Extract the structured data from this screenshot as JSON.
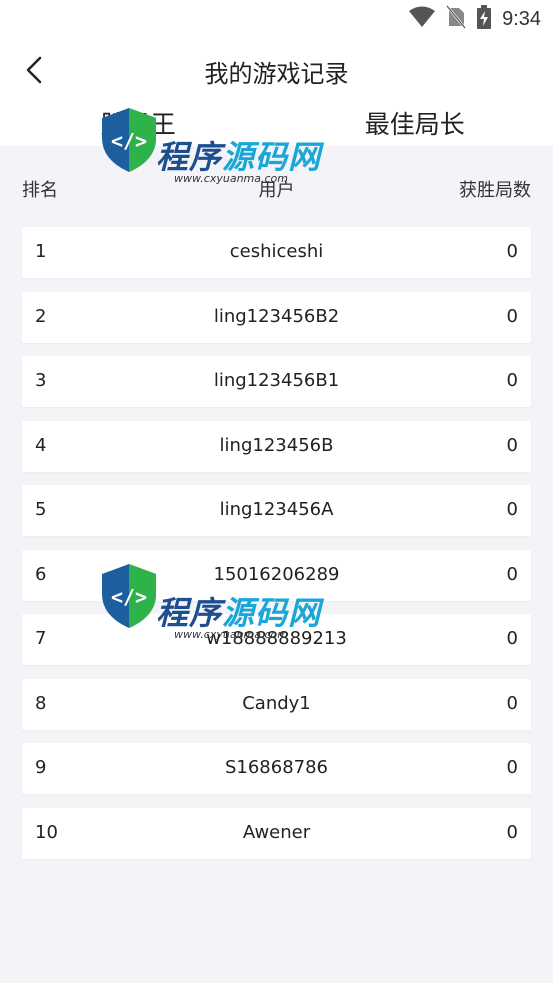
{
  "status_bar": {
    "time": "9:34"
  },
  "header": {
    "title": "我的游戏记录"
  },
  "tabs": [
    {
      "label": "胜场王"
    },
    {
      "label": "最佳局长"
    }
  ],
  "columns": {
    "rank": "排名",
    "user": "用户",
    "wins": "获胜局数"
  },
  "rows": [
    {
      "rank": "1",
      "name": "ceshiceshi",
      "wins": "0"
    },
    {
      "rank": "2",
      "name": "ling123456B2",
      "wins": "0"
    },
    {
      "rank": "3",
      "name": "ling123456B1",
      "wins": "0"
    },
    {
      "rank": "4",
      "name": "ling123456B",
      "wins": "0"
    },
    {
      "rank": "5",
      "name": "ling123456A",
      "wins": "0"
    },
    {
      "rank": "6",
      "name": "15016206289",
      "wins": "0"
    },
    {
      "rank": "7",
      "name": "w18888889213",
      "wins": "0"
    },
    {
      "rank": "8",
      "name": "Candy1",
      "wins": "0"
    },
    {
      "rank": "9",
      "name": "S16868786",
      "wins": "0"
    },
    {
      "rank": "10",
      "name": "Awener",
      "wins": "0"
    }
  ],
  "watermark": {
    "text_a": "程序",
    "text_b": "源码网",
    "url": "www.cxyuanma.com"
  }
}
